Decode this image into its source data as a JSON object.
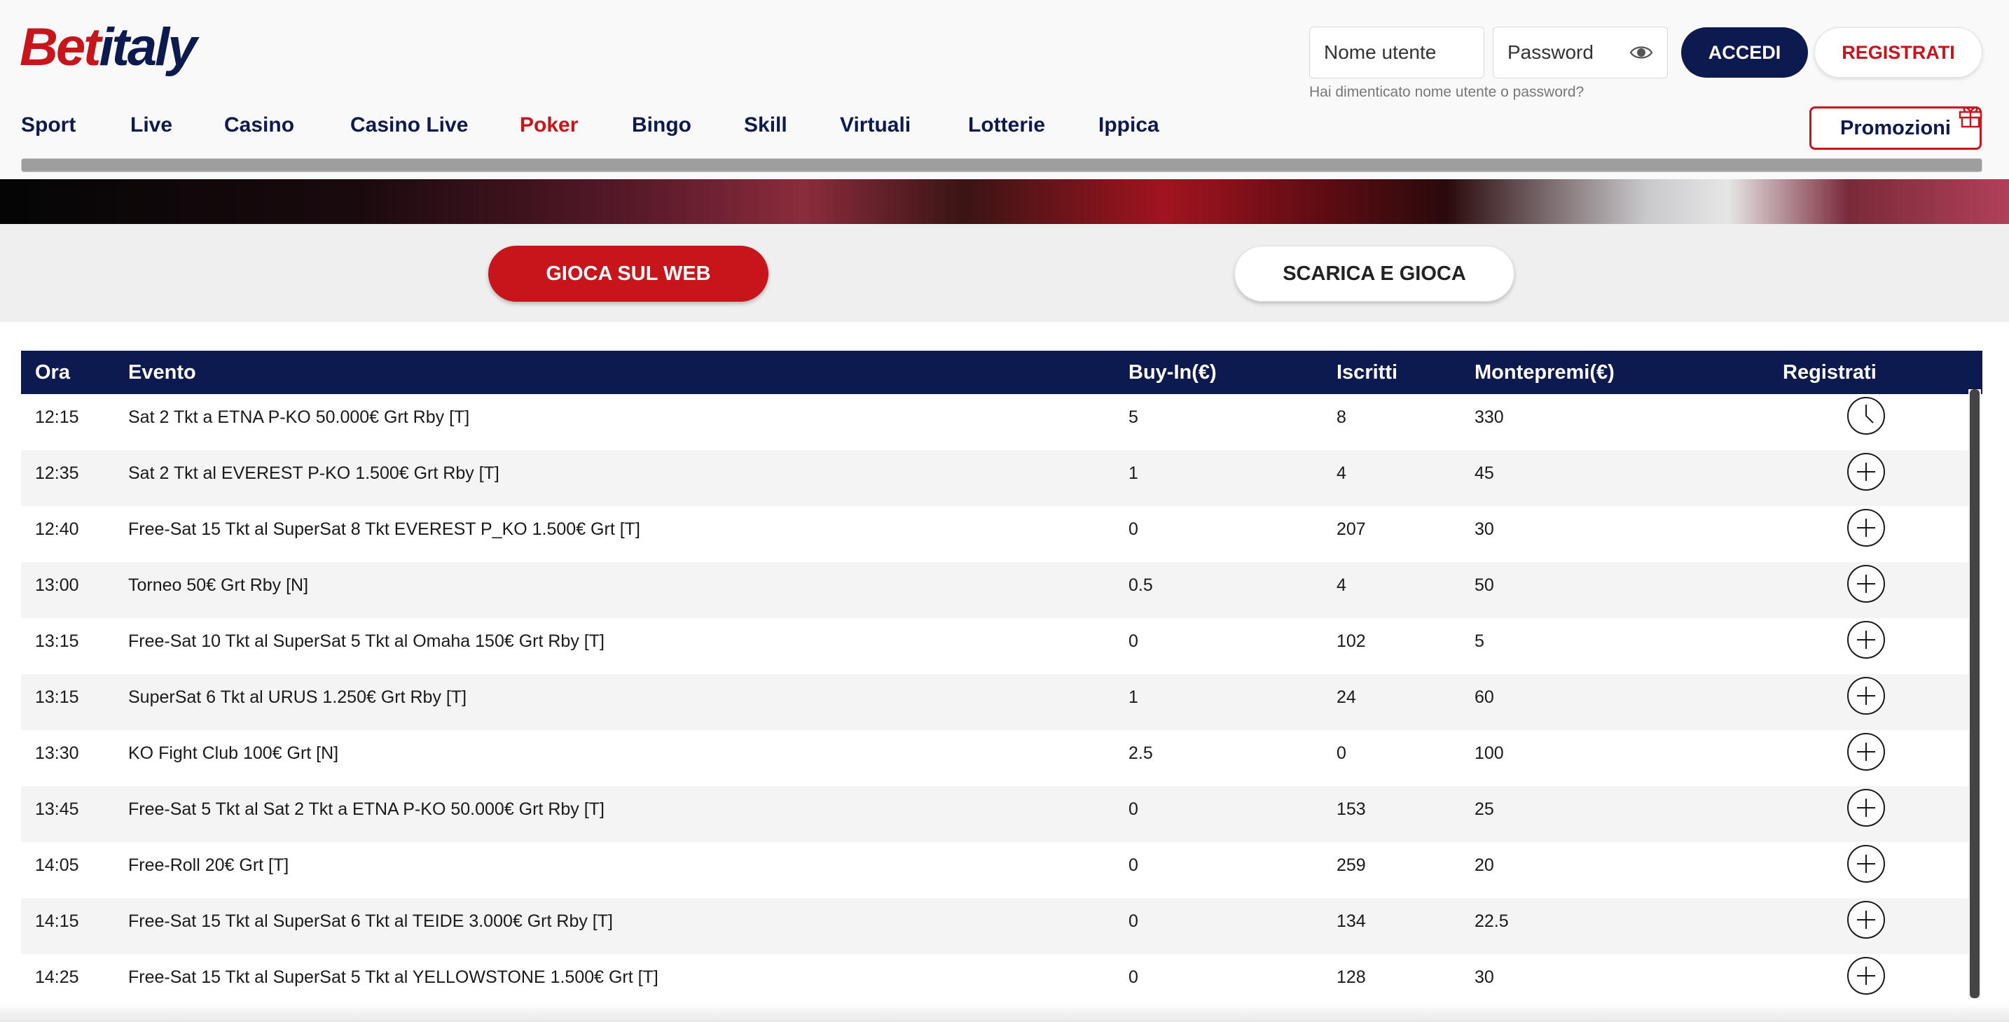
{
  "brand": {
    "part1": "Bet",
    "part2": "italy"
  },
  "login": {
    "username_placeholder": "Nome utente",
    "password_placeholder": "Password",
    "login_label": "ACCEDI",
    "register_label": "REGISTRATI",
    "forgot_text": "Hai dimenticato nome utente o password?"
  },
  "nav": {
    "items": [
      "Sport",
      "Live",
      "Casino",
      "Casino Live",
      "Poker",
      "Bingo",
      "Skill",
      "Virtuali",
      "Lotterie",
      "Ippica"
    ],
    "active": "Poker",
    "promo_label": "Promozioni"
  },
  "actions": {
    "web_label": "GIOCA SUL WEB",
    "download_label": "SCARICA E GIOCA"
  },
  "table": {
    "headers": {
      "time": "Ora",
      "event": "Evento",
      "buyin": "Buy-In(€)",
      "entrants": "Iscritti",
      "prize": "Montepremi(€)",
      "register": "Registrati"
    },
    "rows": [
      {
        "time": "12:15",
        "event": "Sat 2 Tkt a ETNA P-KO 50.000€ Grt Rby [T]",
        "buyin": "5",
        "entrants": "8",
        "prize": "330",
        "action_icon": "clock-icon"
      },
      {
        "time": "12:35",
        "event": "Sat 2 Tkt al EVEREST P-KO 1.500€ Grt Rby   [T]",
        "buyin": "1",
        "entrants": "4",
        "prize": "45",
        "action_icon": "plus-circle-icon"
      },
      {
        "time": "12:40",
        "event": "Free-Sat 15 Tkt al SuperSat 8 Tkt EVEREST P_KO 1.500€ Grt   [T]",
        "buyin": "0",
        "entrants": "207",
        "prize": "30",
        "action_icon": "plus-circle-icon"
      },
      {
        "time": "13:00",
        "event": "Torneo 50€ Grt Rby   [N]",
        "buyin": "0.5",
        "entrants": "4",
        "prize": "50",
        "action_icon": "plus-circle-icon"
      },
      {
        "time": "13:15",
        "event": "Free-Sat 10 Tkt al SuperSat 5 Tkt al Omaha 150€ Grt Rby     [T]",
        "buyin": "0",
        "entrants": "102",
        "prize": "5",
        "action_icon": "plus-circle-icon"
      },
      {
        "time": "13:15",
        "event": "SuperSat 6 Tkt al URUS 1.250€ Grt Rby   [T]",
        "buyin": "1",
        "entrants": "24",
        "prize": "60",
        "action_icon": "plus-circle-icon"
      },
      {
        "time": "13:30",
        "event": "KO Fight Club 100€ Grt   [N]",
        "buyin": "2.5",
        "entrants": "0",
        "prize": "100",
        "action_icon": "plus-circle-icon"
      },
      {
        "time": "13:45",
        "event": "Free-Sat 5 Tkt al Sat 2 Tkt a ETNA P-KO 50.000€ Grt Rby [T]",
        "buyin": "0",
        "entrants": "153",
        "prize": "25",
        "action_icon": "plus-circle-icon"
      },
      {
        "time": "14:05",
        "event": "Free-Roll 20€ Grt   [T]",
        "buyin": "0",
        "entrants": "259",
        "prize": "20",
        "action_icon": "plus-circle-icon"
      },
      {
        "time": "14:15",
        "event": "Free-Sat 15 Tkt al SuperSat 6 Tkt al TEIDE 3.000€ Grt Rby   [T]",
        "buyin": "0",
        "entrants": "134",
        "prize": "22.5",
        "action_icon": "plus-circle-icon"
      },
      {
        "time": "14:25",
        "event": "Free-Sat 15 Tkt al SuperSat 5 Tkt al YELLOWSTONE 1.500€ Grt   [T]",
        "buyin": "0",
        "entrants": "128",
        "prize": "30",
        "action_icon": "plus-circle-icon"
      }
    ]
  },
  "colors": {
    "brand_red": "#c8141b",
    "brand_navy": "#0d1a4f"
  }
}
